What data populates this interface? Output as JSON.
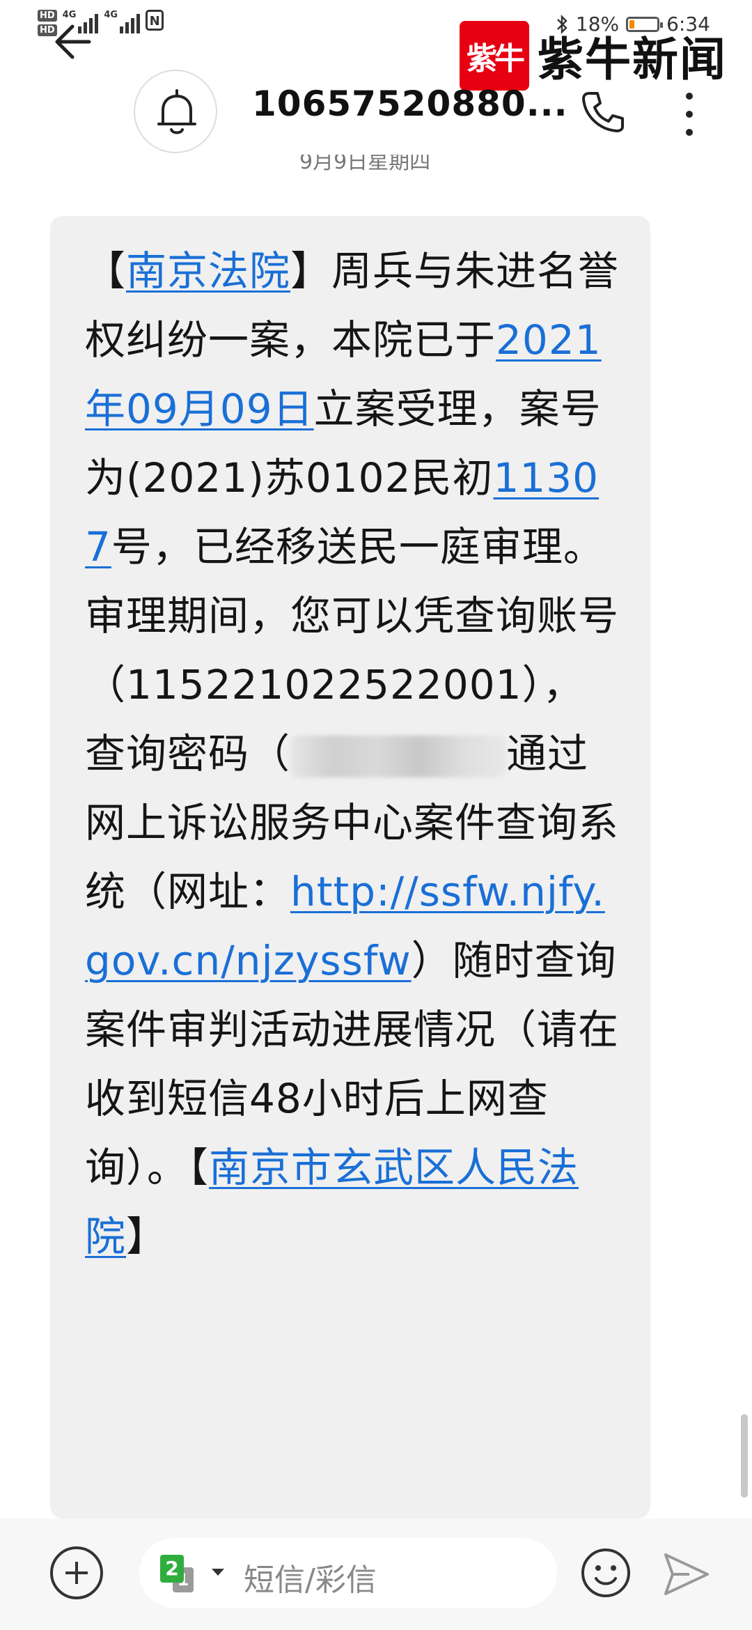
{
  "status_bar": {
    "hd1": "HD",
    "hd2": "HD",
    "net1": "4G",
    "net2": "4G",
    "nfc": "N",
    "bluetooth_icon": "bluetooth-icon",
    "battery_percent": "18%",
    "battery_level": 0.18,
    "time": "6:34"
  },
  "watermark": {
    "mark": "紫牛",
    "text": "紫牛新闻"
  },
  "header": {
    "title": "10657520880...",
    "date_hint": "9月9日星期四"
  },
  "message": {
    "segments": [
      {
        "t": "【"
      },
      {
        "t": "南京法院",
        "link": true
      },
      {
        "t": "】周兵与朱进名誉权纠纷一案，本院已于"
      },
      {
        "t": "2021年09月09日",
        "link": true
      },
      {
        "t": "立案受理，案号为(2021)苏0102民初"
      },
      {
        "t": "11307",
        "link": true
      },
      {
        "t": "号，已经移送民一庭审理。审理期间，您可以凭查询账号（115221022522001），查询密码（"
      },
      {
        "blur": true
      },
      {
        "t": "通过网上诉讼服务中心案件查询系统（网址："
      },
      {
        "t": "http://ssfw.njfy.gov.cn/njzyssfw",
        "link": true
      },
      {
        "t": "）随时查询案件审判活动进展情况（请在收到短信48小时后上网查询）。【"
      },
      {
        "t": "南京市玄武区人民法院",
        "link": true
      },
      {
        "t": "】"
      }
    ]
  },
  "input_bar": {
    "sim_primary": "2",
    "sim_secondary": "1",
    "placeholder": "短信/彩信"
  },
  "colors": {
    "link": "#1a6fd6",
    "bubble": "#f0f0f0",
    "logo_red": "#e60012"
  }
}
